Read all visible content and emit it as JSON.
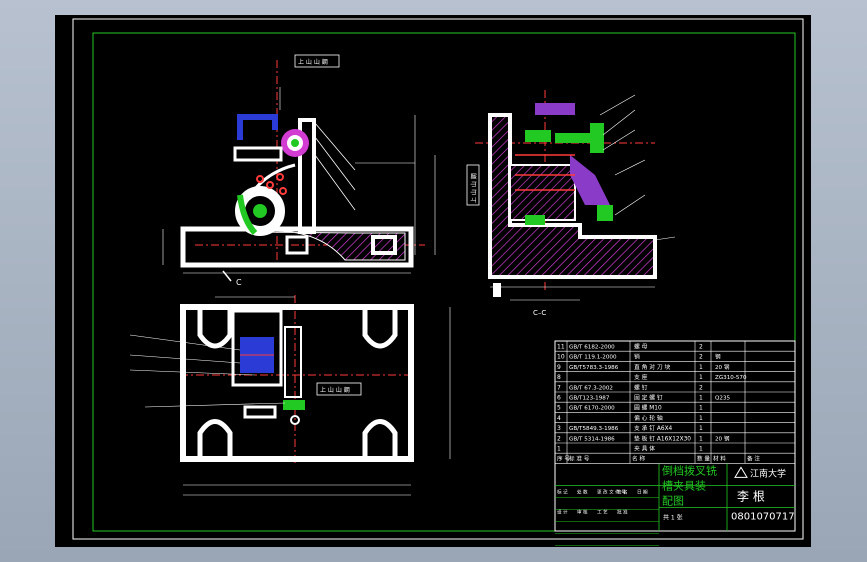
{
  "drawing": {
    "section_label": "C–C",
    "arrow_label": "C",
    "top_tag": "上 山 山 鋼",
    "side_tag": "上 山 山 鋼",
    "bottom_tag": "上 山 山 鋼"
  },
  "title_block": {
    "parts_rows": [
      {
        "no": "11",
        "std": "GB/T 6182-2000",
        "name": "螺 母",
        "qty": "2",
        "mat": ""
      },
      {
        "no": "10",
        "std": "GB/T 119.1-2000",
        "name": "销",
        "qty": "2",
        "mat": "钢"
      },
      {
        "no": "9",
        "std": "GB/T5783.3-1986",
        "name": "直 角 对 刀 块",
        "qty": "1",
        "mat": "20 钢"
      },
      {
        "no": "8",
        "std": "",
        "name": "支 座",
        "qty": "1",
        "mat": "ZG310-570"
      },
      {
        "no": "7",
        "std": "GB/T 67.3-2002",
        "name": "螺 钉",
        "qty": "2",
        "mat": ""
      },
      {
        "no": "6",
        "std": "GB/T123-1987",
        "name": "固 定 螺 钉",
        "qty": "1",
        "mat": "Q235"
      },
      {
        "no": "5",
        "std": "GB/T 6170-2000",
        "name": "圆 螺 M10",
        "qty": "1",
        "mat": ""
      },
      {
        "no": "4",
        "std": "",
        "name": "偏 心 轮 轴",
        "qty": "1",
        "mat": ""
      },
      {
        "no": "3",
        "std": "GB/T5849.3-1986",
        "name": "支 承 钉 A6X4",
        "qty": "1",
        "mat": ""
      },
      {
        "no": "2",
        "std": "GB/T 5314-1986",
        "name": "垫 板 钉 A16X12X30",
        "qty": "1",
        "mat": "20 钢"
      },
      {
        "no": "1",
        "std": "",
        "name": "夹 具 体",
        "qty": "1",
        "mat": ""
      }
    ],
    "header_cells": [
      "序 号",
      "标 准 号",
      "名 称",
      "数 量",
      "材 料",
      "备 注"
    ],
    "drawing_title_line1": "倒档拨叉铣",
    "drawing_title_line2": "槽夹具装",
    "drawing_title_line3": "配图",
    "university": "江南大学",
    "author": "李 根",
    "student_id": "0801070717",
    "sheet_info": "共 1 张",
    "small_labels": [
      "标 记",
      "处 数",
      "更 改 文 件 号",
      "签 名",
      "日 期",
      "设 计",
      "审 核",
      "工 艺",
      "批 准"
    ]
  }
}
